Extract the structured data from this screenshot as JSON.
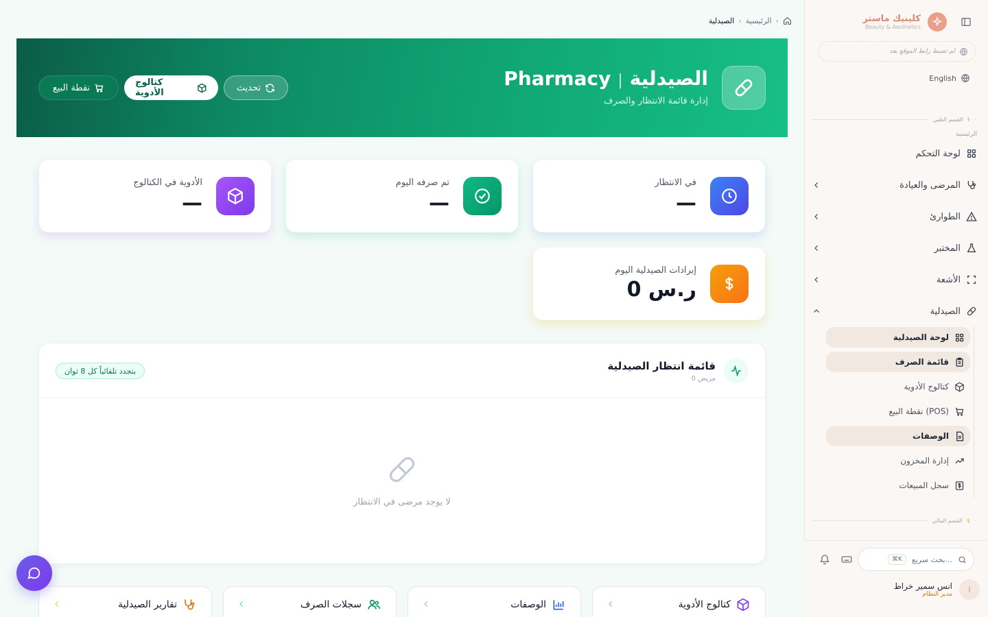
{
  "sidebar": {
    "brand_name": "كلينيك ماستر",
    "brand_sub": "Beauty & Aesthetics",
    "site_link": "لم تضبط رابط الموقع بعد",
    "language": "English",
    "section_medical": "القسم الطبي",
    "group_home": "الرئيسية",
    "items": [
      {
        "label": "لوحة التحكم"
      },
      {
        "label": "المرضى والعيادة"
      },
      {
        "label": "الطوارئ"
      },
      {
        "label": "المختبر"
      },
      {
        "label": "الأشعة"
      },
      {
        "label": "الصيدلية"
      }
    ],
    "pharmacy_sub": [
      {
        "label": "لوحة الصيدلية"
      },
      {
        "label": "قائمة الصرف"
      },
      {
        "label": "كتالوج الأدوية"
      },
      {
        "label": "نقطة البيع (POS)"
      },
      {
        "label": "الوصفات"
      },
      {
        "label": "إدارة المخزون"
      },
      {
        "label": "سجل المبيعات"
      }
    ],
    "section_finance": "القسم المالي",
    "search_placeholder": "بحث سريع...",
    "search_shortcut": "⌘K",
    "user_name": "انس سمير خراط",
    "user_role": "مدير النظام",
    "user_initial": "ا"
  },
  "breadcrumb": {
    "home": "الرئيسية",
    "current": "الصيدلية"
  },
  "hero": {
    "title_ar": "الصيدلية",
    "separator": "|",
    "title_en": "Pharmacy",
    "subtitle": "إدارة قائمة الانتظار والصرف",
    "refresh_label": "تحديث",
    "catalog_label": "كتالوج الأدوية",
    "pos_label": "نقطة البيع"
  },
  "stats": {
    "waiting": {
      "label": "في الانتظار",
      "value": "—",
      "color": "#4f6ef7"
    },
    "dispensed": {
      "label": "تم صرفه اليوم",
      "value": "—",
      "color": "#10b981"
    },
    "catalog": {
      "label": "الأدوية في الكتالوج",
      "value": "—",
      "color": "#a855f7"
    },
    "revenue": {
      "label": "إيرادات الصيدلية اليوم",
      "value": "0 ر.س",
      "color": "#f97316"
    }
  },
  "queue": {
    "title": "قائمة انتظار الصيدلية",
    "count": "0 مريض",
    "badge": "يتجدد تلقائياً كل 8 ثوان",
    "empty": "لا يوجد مرضى في الانتظار"
  },
  "quick_links": [
    {
      "label": "كتالوج الأدوية",
      "icon": "box-icon"
    },
    {
      "label": "الوصفات",
      "icon": "chart-icon"
    },
    {
      "label": "سجلات الصرف",
      "icon": "users-icon"
    },
    {
      "label": "تقارير الصيدلية",
      "icon": "stethoscope-icon"
    }
  ]
}
